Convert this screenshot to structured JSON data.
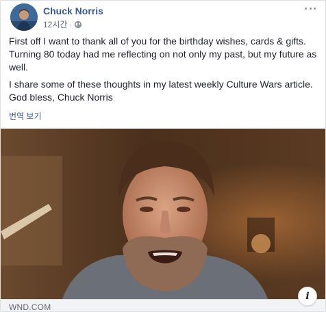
{
  "post": {
    "author": "Chuck Norris",
    "time": "12시간",
    "separator": "·",
    "paragraphs": [
      "First off I want to thank all of you for the birthday wishes, cards & gifts. Turning 80 today had me reflecting on not only my past, but my future as well.",
      "I share some of these thoughts in my latest weekly Culture Wars article. God bless, Chuck Norris"
    ],
    "translate_label": "번역 보기"
  },
  "link": {
    "domain": "WND.COM",
    "info_icon_glyph": "i"
  },
  "icons": {
    "privacy": "globe-icon",
    "more": "more-options-icon",
    "info": "info-icon"
  },
  "colors": {
    "author": "#385898",
    "meta": "#616770",
    "text": "#1d2129",
    "footer_bg": "#f2f3f5"
  }
}
